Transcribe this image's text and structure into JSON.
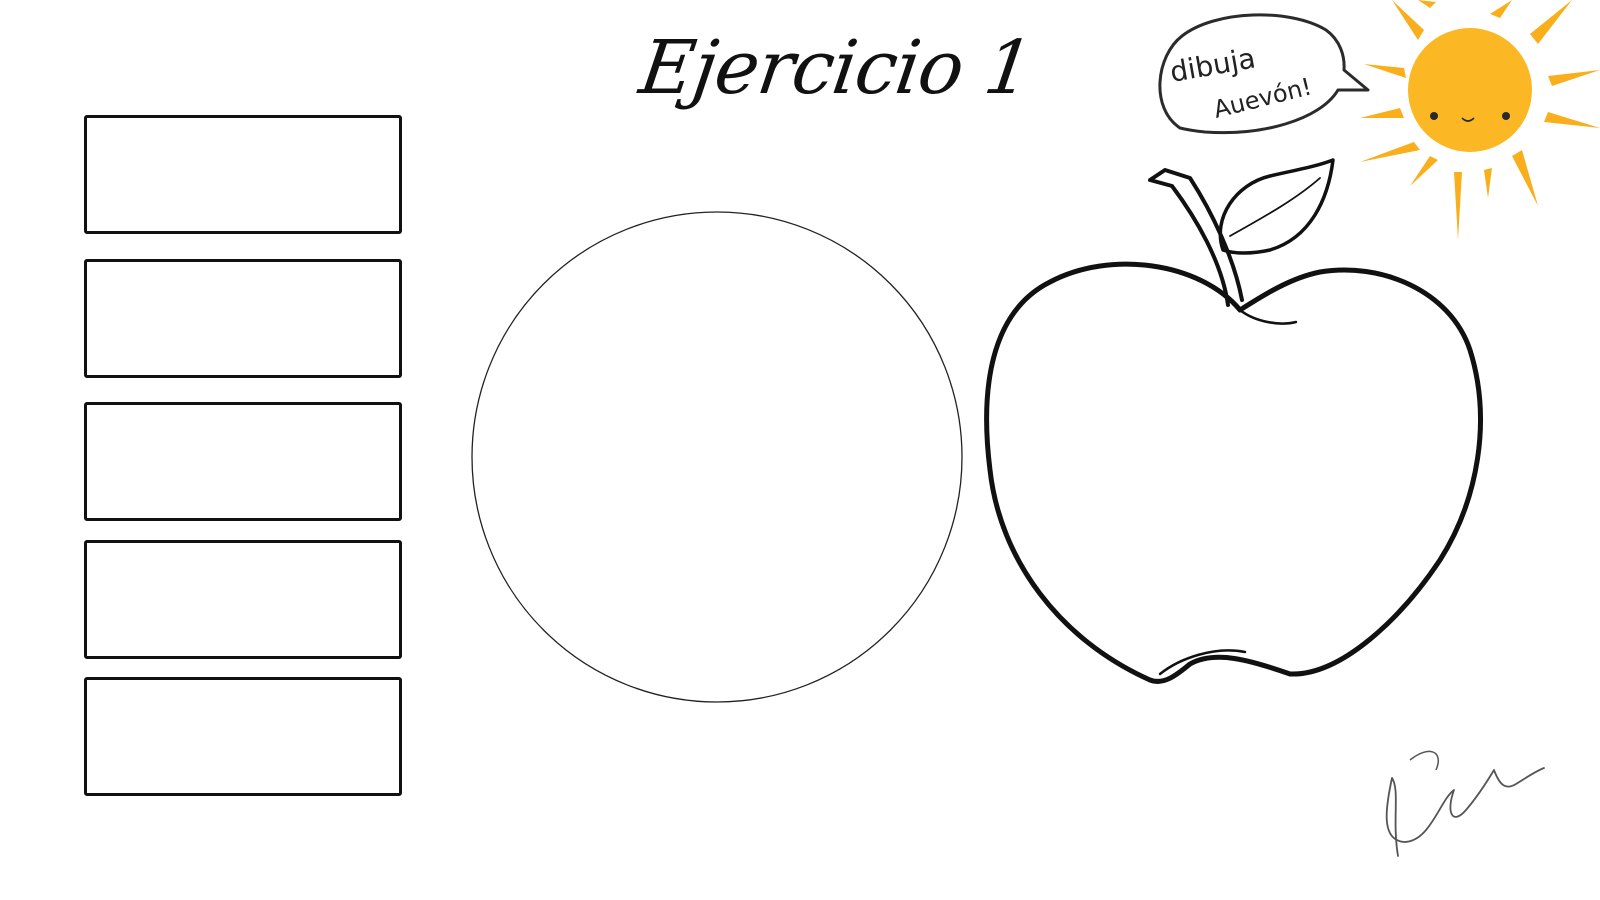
{
  "title": "Ejercicio 1",
  "speech_bubble": {
    "line1": "dibuja",
    "line2": "Auevón!"
  },
  "signature": "Salim Sam",
  "boxes": [
    {
      "label": ""
    },
    {
      "label": ""
    },
    {
      "label": ""
    },
    {
      "label": ""
    },
    {
      "label": ""
    }
  ],
  "colors": {
    "ink": "#111111",
    "sun_fill": "#FBB824",
    "sun_rays": "#F9AF1C",
    "background": "#FFFFFF"
  },
  "icons": [
    "sun-icon",
    "apple-icon",
    "speech-bubble-icon"
  ]
}
